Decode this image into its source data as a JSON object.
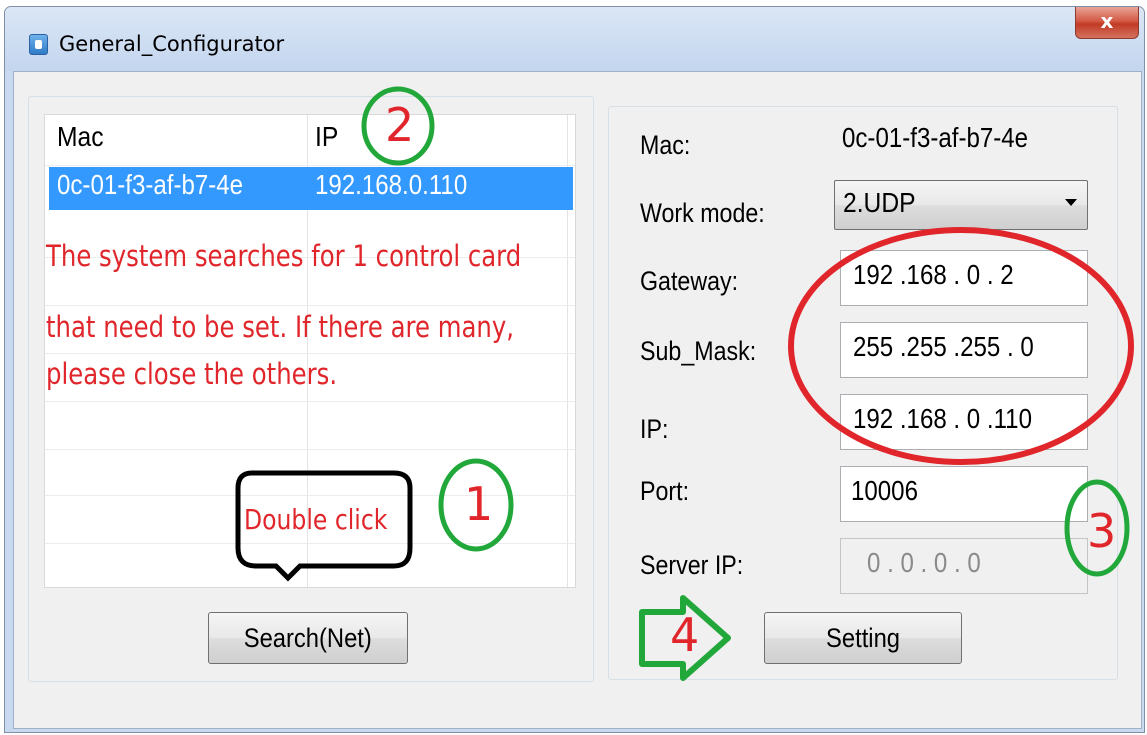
{
  "window": {
    "title": "General_Configurator",
    "close_label": "x"
  },
  "device_list": {
    "columns": [
      "Mac",
      "IP"
    ],
    "selected_row": {
      "mac": "0c-01-f3-af-b7-4e",
      "ip": "192.168.0.110"
    },
    "message_lines": [
      "The system searches for 1 control card",
      "that need to be set. If there are many,",
      "please close the others."
    ],
    "search_button": "Search(Net)"
  },
  "settings": {
    "mac_label": "Mac:",
    "mac_value": "0c-01-f3-af-b7-4e",
    "work_mode_label": "Work mode:",
    "work_mode_value": "2.UDP",
    "gateway_label": "Gateway:",
    "gateway_value": "192 .168 .  0  .  2",
    "submask_label": "Sub_Mask:",
    "submask_value": "255 .255 .255 .  0",
    "ip_label": "IP:",
    "ip_value": "192 .168 .  0  .110",
    "port_label": "Port:",
    "port_value": "10006",
    "server_ip_label": "Server IP:",
    "server_ip_value": "0   .   0   .   0   .   0",
    "setting_button": "Setting"
  },
  "annotations": {
    "double_click_text": "Double click",
    "step1": "1",
    "step2": "2",
    "step3": "3",
    "step4": "4",
    "circle_color": "#22a83a",
    "text_color": "#e0262b",
    "ellipse_color": "#e0262b"
  }
}
